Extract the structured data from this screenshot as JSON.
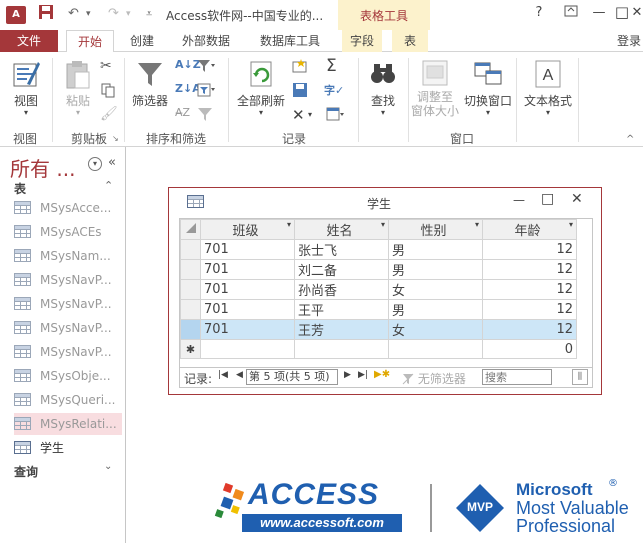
{
  "titlebar": {
    "app_icon": "A",
    "title": "Access软件网--中国专业的...",
    "context_title": "表格工具",
    "help": "?",
    "minimize": "—",
    "maximize": "□",
    "close": "✕"
  },
  "tabs": {
    "file": "文件",
    "home": "开始",
    "create": "创建",
    "external": "外部数据",
    "dbtools": "数据库工具",
    "fields": "字段",
    "table": "表",
    "signin": "登录"
  },
  "ribbon": {
    "view": "视图",
    "paste": "粘贴",
    "filter": "筛选器",
    "refresh_all": "全部刷新",
    "find": "查找",
    "resize_line1": "调整至",
    "resize_line2": "窗体大小",
    "switch_window": "切换窗口",
    "text_format": "文本格式",
    "groups": {
      "views": "视图",
      "clipboard": "剪贴板",
      "sort_filter": "排序和筛选",
      "records": "记录",
      "window": "窗口"
    }
  },
  "nav": {
    "title": "所有 ...",
    "section_tables": "表",
    "section_queries": "查询",
    "items": [
      {
        "label": "MSysAcce..."
      },
      {
        "label": "MSysACEs"
      },
      {
        "label": "MSysNam..."
      },
      {
        "label": "MSysNavP..."
      },
      {
        "label": "MSysNavP..."
      },
      {
        "label": "MSysNavP..."
      },
      {
        "label": "MSysNavP..."
      },
      {
        "label": "MSysObje..."
      },
      {
        "label": "MSysQueri..."
      },
      {
        "label": "MSysRelati..."
      },
      {
        "label": "学生"
      }
    ]
  },
  "datasheet": {
    "title": "学生",
    "columns": [
      "班级",
      "姓名",
      "性别",
      "年龄"
    ],
    "rows": [
      [
        "701",
        "张士飞",
        "男",
        "12"
      ],
      [
        "701",
        "刘二备",
        "男",
        "12"
      ],
      [
        "701",
        "孙尚香",
        "女",
        "12"
      ],
      [
        "701",
        "王平",
        "男",
        "12"
      ],
      [
        "701",
        "王芳",
        "女",
        "12"
      ]
    ],
    "new_row_marker": "✱",
    "new_row_default": "0",
    "record_label": "记录:",
    "record_status": "第 5 项(共 5 项)",
    "no_filter": "无筛选器",
    "search_placeholder": "搜索"
  },
  "logo": {
    "access": "ACCESS",
    "url": "www.accessoft.com",
    "mvp": "MVP",
    "microsoft": "Microsoft",
    "reg": "®",
    "most_valuable": "Most Valuable",
    "professional": "Professional"
  }
}
